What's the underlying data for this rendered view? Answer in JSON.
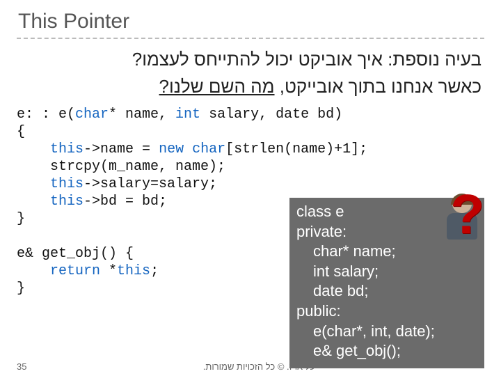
{
  "title": "This Pointer",
  "hebrew": {
    "line1": "בעיה נוספת: איך אוביקט יכול להתייחס לעצמו?",
    "line2_a": "כאשר אנחנו בתוך אובייקט, ",
    "line2_b": "מה השם שלנו?"
  },
  "code": {
    "l1a": "e: : e(",
    "l1b": "char",
    "l1c": "* name, ",
    "l1d": "int",
    "l1e": " salary, date bd)",
    "l2": "{",
    "l3a": "    ",
    "l3b": "this",
    "l3c": "->name = ",
    "l3d": "new char",
    "l3e": "[strlen(name)+1];",
    "l4": "    strcpy(m_name, name);",
    "l5a": "    ",
    "l5b": "this",
    "l5c": "->salary=salary;",
    "l6a": "    ",
    "l6b": "this",
    "l6c": "->bd = bd;",
    "l7": "}",
    "blank": "",
    "l8": "e& get_obj() {",
    "l9a": "    ",
    "l9b": "return",
    "l9c": " *",
    "l9d": "this",
    "l9e": ";",
    "l10": "}"
  },
  "classbox": {
    "l1": "class e",
    "l2": "private:",
    "l3": "char* name;",
    "l4": "int salary;",
    "l5": "date bd;",
    "l6": "public:",
    "l7": "e(char*, int, date);",
    "l8": "e& get_obj();"
  },
  "qmark": "?",
  "footer": {
    "page": "35",
    "copyright": "\"י יעל ארז. © כל הזכויות שמורות."
  }
}
